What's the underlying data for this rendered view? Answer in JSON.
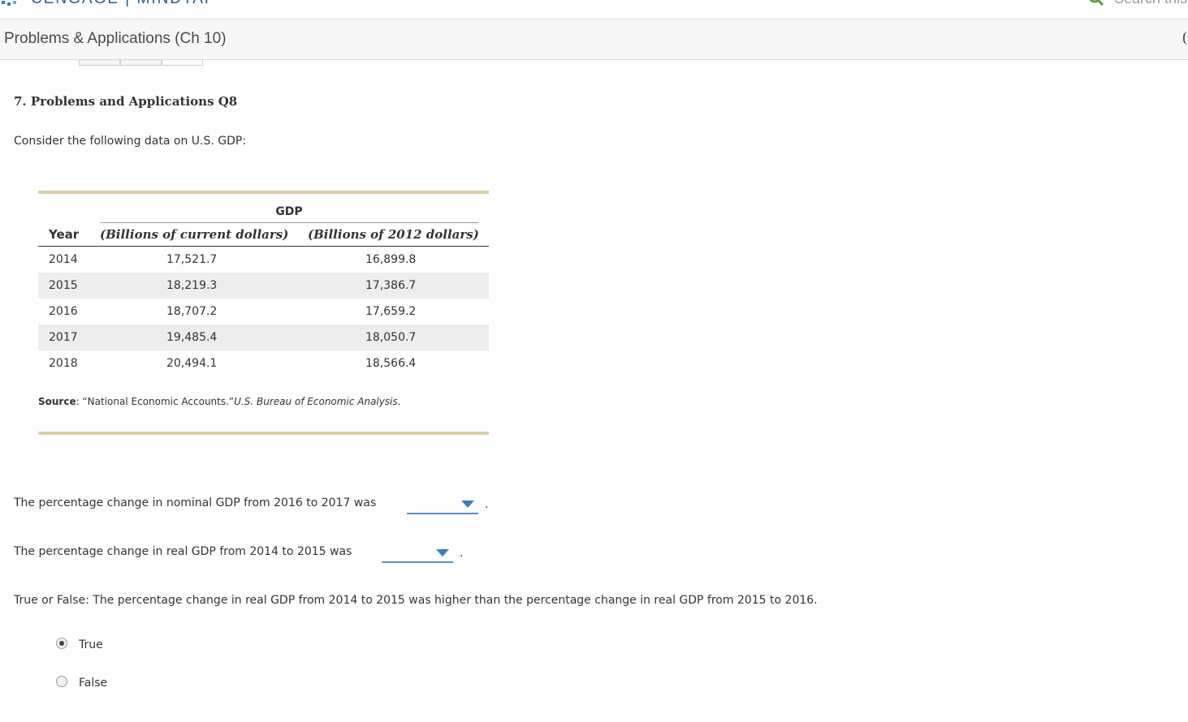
{
  "brand": {
    "name": "CENGAGE | MINDTAP"
  },
  "search": {
    "placeholder": "Search this"
  },
  "header": {
    "title": "Problems & Applications (Ch 10)"
  },
  "question": {
    "heading": "7. Problems and Applications Q8",
    "intro": "Consider the following data on U.S. GDP:"
  },
  "table": {
    "group_header": "GDP",
    "columns": [
      "Year",
      "(Billions of current dollars)",
      "(Billions of 2012 dollars)"
    ],
    "rows": [
      [
        "2014",
        "17,521.7",
        "16,899.8"
      ],
      [
        "2015",
        "18,219.3",
        "17,386.7"
      ],
      [
        "2016",
        "18,707.2",
        "17,659.2"
      ],
      [
        "2017",
        "19,485.4",
        "18,050.7"
      ],
      [
        "2018",
        "20,494.1",
        "18,566.4"
      ]
    ],
    "source_label": "Source",
    "source_text": ": “National Economic Accounts.”",
    "source_publisher": "U.S. Bureau of Economic Analysis",
    "source_end": "."
  },
  "prompts": {
    "nominal": "The percentage change in nominal GDP from 2016 to 2017 was",
    "real": "The percentage change in real GDP from 2014 to 2015 was",
    "period": ".",
    "true_false": "True or False: The percentage change in real GDP from 2014 to 2015 was higher than the percentage change in real GDP from 2015 to 2016."
  },
  "options": {
    "true_label": "True",
    "false_label": "False",
    "selected": "True"
  },
  "colors": {
    "accent": "#3c7ec5",
    "table_rule": "#dcd0a7",
    "row_shade": "#ededed"
  },
  "icons": [
    "cengage-logo-icon",
    "search-icon",
    "dropdown-caret-icon",
    "radio-icon"
  ]
}
